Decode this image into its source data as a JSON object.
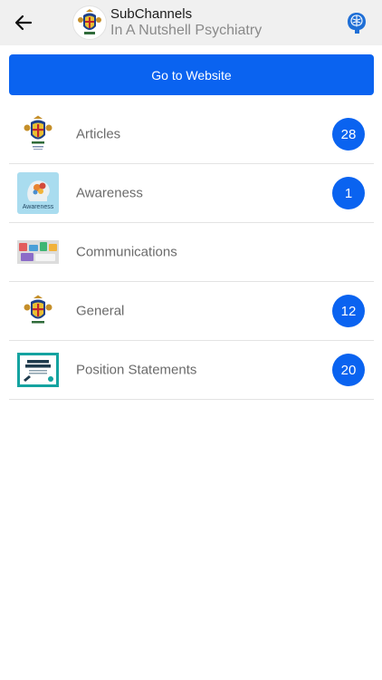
{
  "header": {
    "title": "SubChannels",
    "subtitle": "In A Nutshell Psychiatry",
    "back_icon": "arrow-left-icon",
    "avatar_icon": "coat-of-arms-logo",
    "action_icon": "brain-icon"
  },
  "website_button": {
    "label": "Go to Website"
  },
  "colors": {
    "accent": "#0a63f0",
    "header_bg": "#f0f0f0",
    "label_text": "#6b6b6b"
  },
  "channels": [
    {
      "label": "Articles",
      "count": "28",
      "thumb": "coat-of-arms-logo"
    },
    {
      "label": "Awareness",
      "count": "1",
      "thumb": "awareness-image",
      "thumb_caption": "Awareness"
    },
    {
      "label": "Communications",
      "count": "",
      "thumb": "communications-image"
    },
    {
      "label": "General",
      "count": "12",
      "thumb": "coat-of-arms-logo"
    },
    {
      "label": "Position Statements",
      "count": "20",
      "thumb": "position-statements-image"
    }
  ]
}
